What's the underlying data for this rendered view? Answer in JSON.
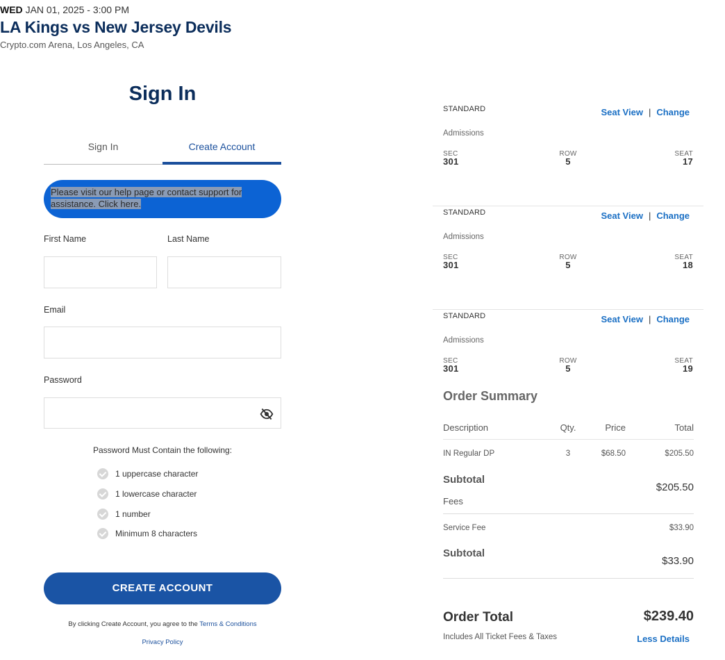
{
  "event": {
    "day": "WED",
    "datetime": "JAN 01, 2025 - 3:00 PM",
    "title": "LA Kings vs New Jersey Devils",
    "venue": "Crypto.com Arena, Los Angeles, CA"
  },
  "signin": {
    "heading": "Sign In",
    "tabs": [
      {
        "label": "Sign In",
        "active": false
      },
      {
        "label": "Create Account",
        "active": true
      }
    ],
    "notice": "Please visit our help page or contact support for assistance. Click here.",
    "labels": {
      "first_name": "First Name",
      "last_name": "Last Name",
      "email": "Email",
      "password": "Password"
    },
    "password_rules_title": "Password Must Contain the following:",
    "password_rules": [
      "1 uppercase character",
      "1 lowercase character",
      "1 number",
      "Minimum 8 characters"
    ],
    "create_button": "CREATE ACCOUNT",
    "legal_prefix": "By clicking Create Account, you agree to the",
    "terms_link": "Terms & Conditions",
    "privacy_link": "Privacy Policy"
  },
  "tickets": [
    {
      "type": "STANDARD",
      "seat_view": "Seat View",
      "sep": "|",
      "change": "Change",
      "admission": "Admissions",
      "sec_label": "SEC",
      "sec": "301",
      "row_label": "ROW",
      "row": "5",
      "seat_label": "SEAT",
      "seat": "17"
    },
    {
      "type": "STANDARD",
      "seat_view": "Seat View",
      "sep": "|",
      "change": "Change",
      "admission": "Admissions",
      "sec_label": "SEC",
      "sec": "301",
      "row_label": "ROW",
      "row": "5",
      "seat_label": "SEAT",
      "seat": "18"
    },
    {
      "type": "STANDARD",
      "seat_view": "Seat View",
      "sep": "|",
      "change": "Change",
      "admission": "Admissions",
      "sec_label": "SEC",
      "sec": "301",
      "row_label": "ROW",
      "row": "5",
      "seat_label": "SEAT",
      "seat": "19"
    }
  ],
  "summary": {
    "title": "Order Summary",
    "columns": {
      "description": "Description",
      "qty": "Qty.",
      "price": "Price",
      "total": "Total"
    },
    "line": {
      "description": "IN Regular DP",
      "qty": "3",
      "price": "$68.50",
      "total": "$205.50"
    },
    "subtotal_label": "Subtotal",
    "subtotal_value": "$205.50",
    "fees_label": "Fees",
    "fee": {
      "description": "Service Fee",
      "total": "$33.90"
    },
    "fees_subtotal_label": "Subtotal",
    "fees_subtotal_value": "$33.90",
    "order_total_label": "Order Total",
    "order_total_value": "$239.40",
    "total_note": "Includes All Ticket Fees & Taxes",
    "less_details": "Less Details"
  },
  "colors": {
    "brand_navy": "#0b2d5b",
    "button_blue": "#1a54a5",
    "link_blue": "#1a6fc4",
    "notice_blue": "#0c63d4"
  }
}
